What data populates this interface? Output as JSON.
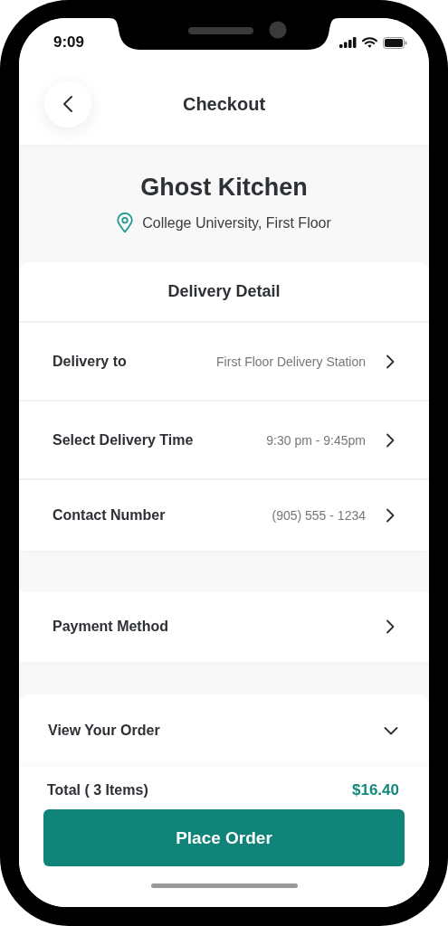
{
  "status_bar": {
    "time": "9:09"
  },
  "header": {
    "title": "Checkout"
  },
  "restaurant": {
    "name": "Ghost Kitchen",
    "location": "College University, First Floor"
  },
  "delivery_detail": {
    "title": "Delivery Detail",
    "rows": [
      {
        "label": "Delivery to",
        "value": "First Floor Delivery Station"
      },
      {
        "label": "Select Delivery Time",
        "value": "9:30 pm - 9:45pm"
      },
      {
        "label": "Contact Number",
        "value": "(905) 555 - 1234"
      }
    ]
  },
  "payment": {
    "label": "Payment Method"
  },
  "order": {
    "label": "View Your Order",
    "expanded": false
  },
  "footer": {
    "total_label": "Total ( 3 Items)",
    "total": "$16.40",
    "button": "Place Order"
  }
}
